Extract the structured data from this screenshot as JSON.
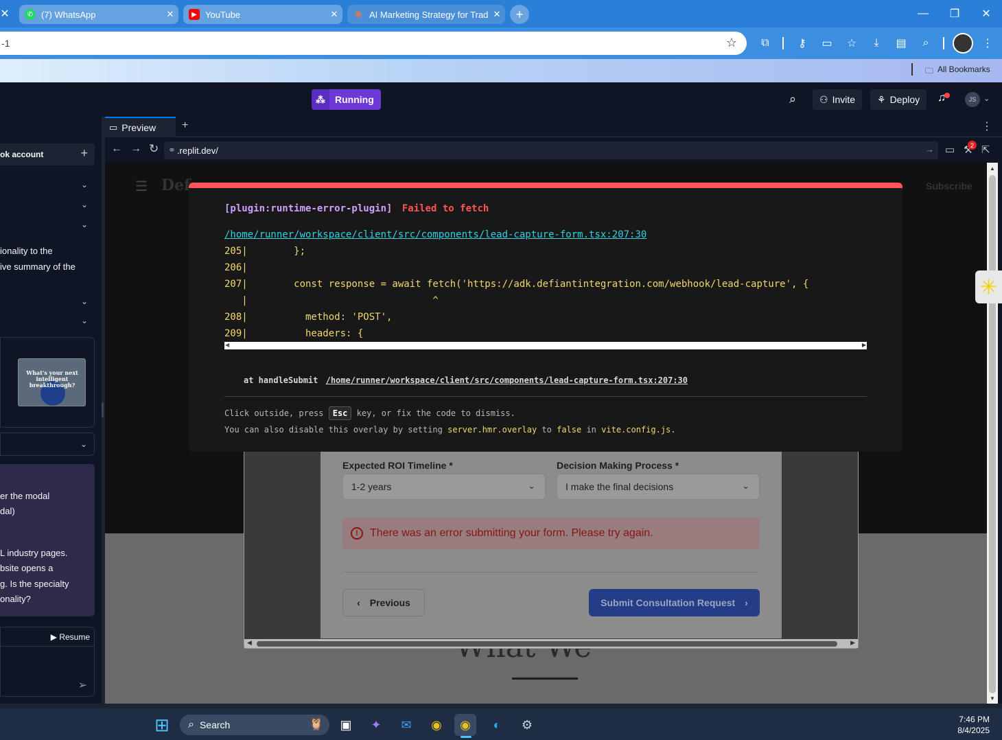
{
  "browser": {
    "tabs": [
      {
        "label": "(7) WhatsApp",
        "icon": "whatsapp-icon"
      },
      {
        "label": "YouTube",
        "icon": "youtube-icon"
      },
      {
        "label": "AI Marketing Strategy for Trade",
        "icon": "claude-icon"
      }
    ],
    "url_fragment": "-1",
    "bookmarks_label": "All Bookmarks"
  },
  "replit": {
    "running_label": "Running",
    "invite_label": "Invite",
    "deploy_label": "Deploy",
    "avatar_initials": "JS",
    "preview_tab_label": "Preview",
    "preview_url": ".replit.dev/",
    "badge_count": "2"
  },
  "left_panel": {
    "account_label": "ok account",
    "text1": "ionality to the",
    "text2": "ive summary of the",
    "thumb_text": "What's your next intelligent breakthrough?",
    "chat_lines": [
      "er the modal",
      "dal)",
      "L industry pages.",
      "bsite opens a",
      "g. Is the specialty",
      "onality?"
    ],
    "resume_label": "Resume"
  },
  "website": {
    "header_partial": "Def",
    "subscribe": "Subscribe",
    "roi_label": "Expected ROI Timeline *",
    "roi_value": "1-2 years",
    "decision_label": "Decision Making Process *",
    "decision_value": "I make the final decisions",
    "error_message": "There was an error submitting your form. Please try again.",
    "previous_label": "Previous",
    "submit_label": "Submit Consultation Request",
    "heading_partial": "What We"
  },
  "overlay": {
    "plugin": "[plugin:runtime-error-plugin]",
    "message": "Failed to fetch",
    "file": "/home/runner/workspace/client/src/components/lead-capture-form.tsx:207:30",
    "code": [
      "205|        };",
      "206|",
      "207|        const response = await fetch('https://adk.defiantintegration.com/webhook/lead-capture', {",
      "   |                                ^",
      "208|          method: 'POST',",
      "209|          headers: {"
    ],
    "stack_prefix": "at handleSubmit",
    "stack_file": "/home/runner/workspace/client/src/components/lead-capture-form.tsx:207:30",
    "tip1_a": "Click outside, press",
    "tip1_key": "Esc",
    "tip1_b": "key, or fix the code to dismiss.",
    "tip2_a": "You can also disable this overlay by setting",
    "tip2_setting": "server.hmr.overlay",
    "tip2_b": "to",
    "tip2_false": "false",
    "tip2_c": "in",
    "tip2_file": "vite.config.js."
  },
  "taskbar": {
    "search_label": "Search",
    "time": "7:46 PM",
    "date": "8/4/2025"
  },
  "colors": {
    "overlay_red": "#ff5555",
    "plugin_purple": "#cfa0ff",
    "link_cyan": "#2dd4e4",
    "running_purple": "#6d38d6"
  }
}
